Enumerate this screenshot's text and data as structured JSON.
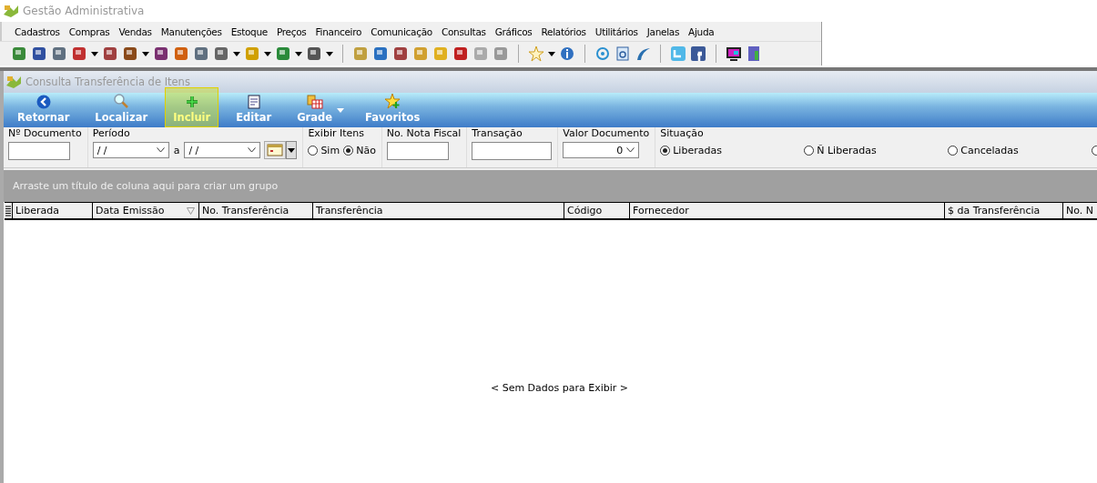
{
  "app_title": "Gestão Administrativa",
  "menu": [
    "Cadastros",
    "Compras",
    "Vendas",
    "Manutenções",
    "Estoque",
    "Preços",
    "Financeiro",
    "Comunicação",
    "Consultas",
    "Gráficos",
    "Relatórios",
    "Utilitários",
    "Janelas",
    "Ajuda"
  ],
  "form_title": "Consulta Transferência de Itens",
  "ribbon": [
    {
      "label": "Retornar",
      "kind": "back",
      "highlighted": false,
      "dropdown": false
    },
    {
      "label": "Localizar",
      "kind": "search",
      "highlighted": false,
      "dropdown": false
    },
    {
      "label": "Incluir",
      "kind": "add",
      "highlighted": true,
      "dropdown": false
    },
    {
      "label": "Editar",
      "kind": "edit",
      "highlighted": false,
      "dropdown": false
    },
    {
      "label": "Grade",
      "kind": "grid",
      "highlighted": false,
      "dropdown": true
    },
    {
      "label": "Favoritos",
      "kind": "star",
      "highlighted": false,
      "dropdown": false
    }
  ],
  "filters": {
    "documento": {
      "label": "Nº Documento"
    },
    "periodo": {
      "label": "Período",
      "from": "/ /",
      "separator": "a",
      "to": "/ /"
    },
    "exibir_itens": {
      "label": "Exibir Itens",
      "options": [
        {
          "label": "Sim",
          "selected": false
        },
        {
          "label": "Não",
          "selected": true
        }
      ]
    },
    "nota_fiscal": {
      "label": "No. Nota Fiscal"
    },
    "transacao": {
      "label": "Transação"
    },
    "valor_documento": {
      "label": "Valor Documento",
      "value": "0"
    },
    "situacao": {
      "label": "Situação",
      "options": [
        {
          "label": "Liberadas",
          "selected": true
        },
        {
          "label": "Ñ Liberadas",
          "selected": false
        },
        {
          "label": "Canceladas",
          "selected": false
        },
        {
          "selected": false
        }
      ]
    }
  },
  "group_hint": "Arraste um título de coluna aqui para criar um grupo",
  "columns": [
    {
      "label": "Liberada",
      "filter": false
    },
    {
      "label": "Data Emissão",
      "filter": true
    },
    {
      "label": "No. Transferência",
      "filter": false
    },
    {
      "label": "Transferência",
      "filter": false
    },
    {
      "label": "Código",
      "filter": false
    },
    {
      "label": "Fornecedor",
      "filter": false
    },
    {
      "label": "$ da Transferência",
      "filter": false
    },
    {
      "label": "No. N",
      "filter": false
    }
  ],
  "empty_message": "< Sem Dados para Exibir >"
}
